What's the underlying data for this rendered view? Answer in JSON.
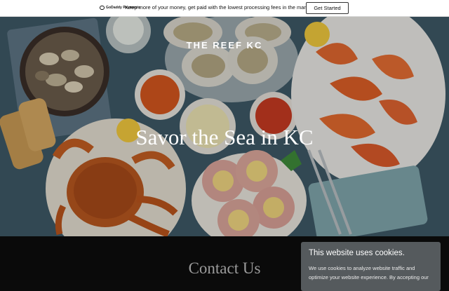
{
  "promo": {
    "logo_text": "GoDaddy Payments",
    "message": "Keep more of your money, get paid with the lowest processing fees in the market.",
    "cta_label": "Get Started"
  },
  "hero": {
    "site_title": "THE REEF KC",
    "heading": "Savor the Sea in KC"
  },
  "contact": {
    "title": "Contact Us"
  },
  "cookie": {
    "title": "This website uses cookies.",
    "body_line1": "We use cookies to analyze website traffic and",
    "body_line2": "optimize your website experience. By accepting our"
  },
  "colors": {
    "hero_background": "#3d5866",
    "page_background": "#0a0a0a",
    "cookie_background": "#555a5d"
  }
}
